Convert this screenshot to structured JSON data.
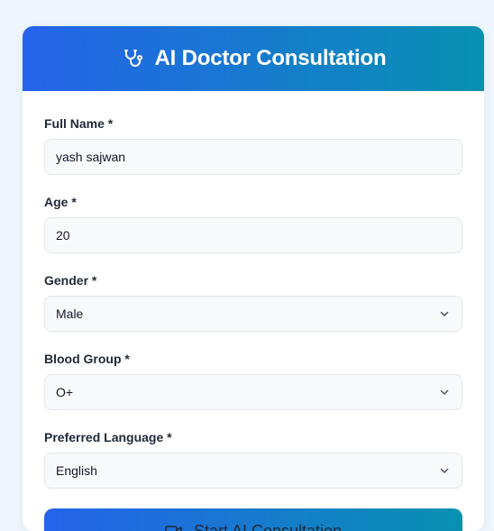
{
  "header": {
    "title": "AI Doctor Consultation",
    "icon": "stethoscope-icon"
  },
  "form": {
    "full_name": {
      "label": "Full Name *",
      "value": "yash sajwan"
    },
    "age": {
      "label": "Age *",
      "value": "20"
    },
    "gender": {
      "label": "Gender *",
      "value": "Male"
    },
    "blood_group": {
      "label": "Blood Group *",
      "value": "O+"
    },
    "language": {
      "label": "Preferred Language *",
      "value": "English"
    }
  },
  "actions": {
    "start_label": "Start AI Consultation",
    "start_icon": "video-camera-icon"
  },
  "colors": {
    "gradient_start": "#2563eb",
    "gradient_end": "#0891b2",
    "page_background": "#eef6fc"
  }
}
